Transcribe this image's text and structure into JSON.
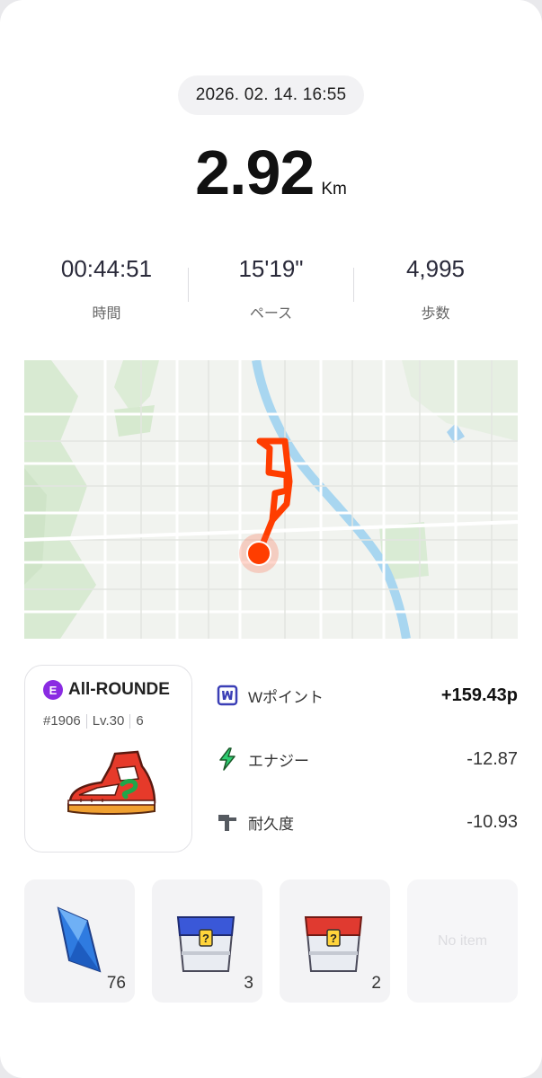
{
  "datetime": "2026. 02. 14. 16:55",
  "distance": {
    "value": "2.92",
    "unit": "Km"
  },
  "stats": [
    {
      "value": "00:44:51",
      "label": "時間"
    },
    {
      "value": "15'19\"",
      "label": "ペース"
    },
    {
      "value": "4,995",
      "label": "歩数"
    }
  ],
  "sneaker": {
    "badge": "E",
    "name": "All-ROUNDE",
    "id": "#1906",
    "level": "Lv.30",
    "extra_glyph": "6"
  },
  "rewards": [
    {
      "icon": "w-point-icon",
      "label": "Wポイント",
      "value": "+159.43p"
    },
    {
      "icon": "energy-bolt-icon",
      "label": "エナジー",
      "value": "-12.87"
    },
    {
      "icon": "durability-icon",
      "label": "耐久度",
      "value": "-10.93"
    }
  ],
  "items": [
    {
      "icon": "blue-crystal-icon",
      "count": "76"
    },
    {
      "icon": "blue-mystery-box-icon",
      "count": "3"
    },
    {
      "icon": "red-mystery-box-icon",
      "count": "2"
    },
    {
      "icon": "",
      "empty_label": "No item"
    }
  ],
  "colors": {
    "route": "#ff3d00",
    "energy": "#2ecc71",
    "w_point": "#3b3fb6",
    "badge_purple": "#8a2be2"
  }
}
